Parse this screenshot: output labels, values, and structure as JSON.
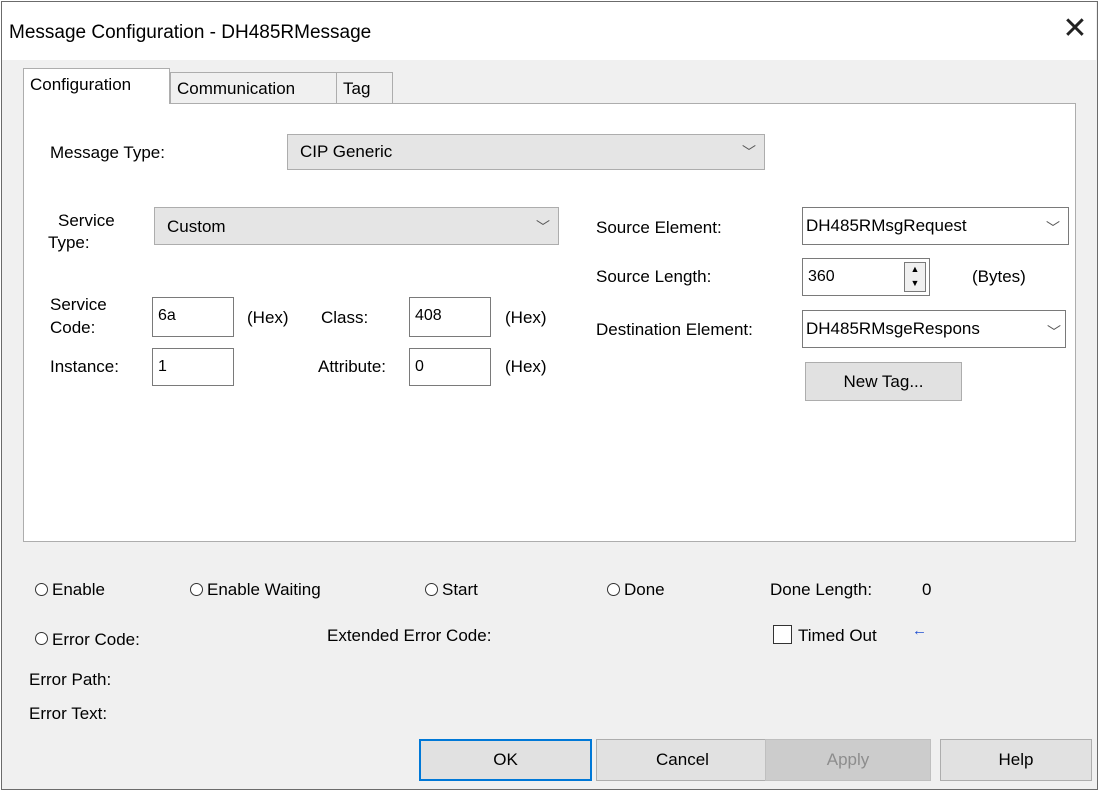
{
  "dialog": {
    "title": "Message Configuration - DH485RMessage",
    "close_glyph": "✕"
  },
  "tabs": [
    {
      "label": "Configuration",
      "active": true
    },
    {
      "label": "Communication",
      "active": false
    },
    {
      "label": "Tag",
      "active": false
    }
  ],
  "config": {
    "message_type_label": "Message Type:",
    "message_type_value": "CIP Generic",
    "service_type_label_1": "Service",
    "service_type_label_2": "Type:",
    "service_type_value": "Custom",
    "service_code_label_1": "Service",
    "service_code_label_2": "Code:",
    "service_code_value": "6a",
    "hex_label": "(Hex)",
    "class_label": "Class:",
    "class_value": "408",
    "instance_label": "Instance:",
    "instance_value": "1",
    "attribute_label": "Attribute:",
    "attribute_value": "0",
    "source_element_label": "Source Element:",
    "source_element_value": "DH485RMsgRequest",
    "source_length_label": "Source Length:",
    "source_length_value": "360",
    "bytes_label": "(Bytes)",
    "destination_element_label": "Destination Element:",
    "destination_element_value": "DH485RMsgeRespons",
    "new_tag_button": "New Tag..."
  },
  "status": {
    "enable": "Enable",
    "enable_waiting": "Enable Waiting",
    "start": "Start",
    "done": "Done",
    "done_length_label": "Done Length:",
    "done_length_value": "0",
    "error_code_label": "Error Code:",
    "extended_error_code_label": "Extended Error Code:",
    "timed_out_label": "Timed Out",
    "timed_out_arrow": "←",
    "error_path_label": "Error Path:",
    "error_text_label": "Error Text:"
  },
  "buttons": {
    "ok": "OK",
    "cancel": "Cancel",
    "apply": "Apply",
    "help": "Help"
  },
  "icons": {
    "dropdown": "chevron-down-icon",
    "close": "close-icon",
    "spin_up": "▲",
    "spin_down": "▼",
    "chevron_glyph": "﹀"
  },
  "colors": {
    "dialog_bg": "#f0f0f0",
    "default_button_border": "#0078d7",
    "timed_out_arrow": "#1f4fd1"
  }
}
